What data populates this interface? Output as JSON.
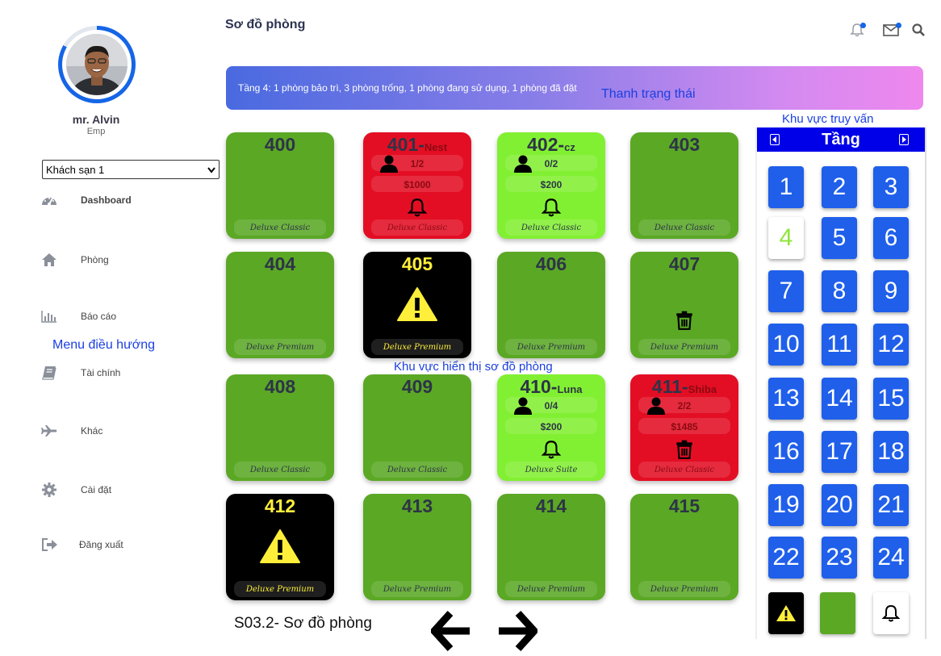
{
  "header": {
    "title": "Sơ đồ phòng"
  },
  "user": {
    "name": "mr. Alvin",
    "role": "Emp"
  },
  "hotel_select": {
    "selected": "Khách sạn 1"
  },
  "menu": [
    {
      "label": "Dashboard",
      "icon": "dashboard-icon"
    },
    {
      "label": "Phòng",
      "icon": "home-icon"
    },
    {
      "label": "Báo cáo",
      "icon": "chart-icon"
    },
    {
      "label": "Tài chính",
      "icon": "book-icon"
    },
    {
      "label": "Khác",
      "icon": "plane-icon"
    },
    {
      "label": "Cài đặt",
      "icon": "gear-icon"
    },
    {
      "label": "Đăng xuất",
      "icon": "logout-icon"
    }
  ],
  "annotations": {
    "status_bar": "Thanh trạng thái",
    "query_area": "Khu vực truy vấn",
    "menu": "Menu điều hướng",
    "room_map": "Khu vực hiển thị sơ đồ phòng"
  },
  "status_text": "Tầng 4: 1 phòng bảo trì, 3 phòng trống, 1 phòng đang sử dụng, 1 phòng đã đặt",
  "rooms": [
    {
      "number": "400",
      "type": "Deluxe Classic",
      "status": "vacant"
    },
    {
      "number": "401-",
      "guest": "Nest",
      "occupancy": "1/2",
      "price": "$1000",
      "type": "Deluxe Classic",
      "status": "occupied",
      "icon": "bell-icon"
    },
    {
      "number": "402-",
      "guest": "cz",
      "occupancy": "0/2",
      "price": "$200",
      "type": "Deluxe Classic",
      "status": "booked",
      "icon": "bell-icon"
    },
    {
      "number": "403",
      "type": "Deluxe Classic",
      "status": "vacant"
    },
    {
      "number": "404",
      "type": "Deluxe Premium",
      "status": "vacant"
    },
    {
      "number": "405",
      "type": "Deluxe Premium",
      "status": "maintenance",
      "icon": "warning-icon"
    },
    {
      "number": "406",
      "type": "Deluxe Premium",
      "status": "vacant"
    },
    {
      "number": "407",
      "type": "Deluxe Premium",
      "status": "vacant",
      "icon": "trash-icon"
    },
    {
      "number": "408",
      "type": "Deluxe Classic",
      "status": "vacant"
    },
    {
      "number": "409",
      "type": "Deluxe Classic",
      "status": "vacant"
    },
    {
      "number": "410-",
      "guest": "Luna",
      "occupancy": "0/4",
      "price": "$200",
      "type": "Deluxe Suite",
      "status": "booked",
      "icon": "bell-icon"
    },
    {
      "number": "411-",
      "guest": "Shiba",
      "occupancy": "2/2",
      "price": "$1485",
      "type": "Deluxe Classic",
      "status": "occupied",
      "icon": "trash-icon"
    },
    {
      "number": "412",
      "type": "Deluxe Premium",
      "status": "maintenance",
      "icon": "warning-icon"
    },
    {
      "number": "413",
      "type": "Deluxe Premium",
      "status": "vacant"
    },
    {
      "number": "414",
      "type": "Deluxe Premium",
      "status": "vacant"
    },
    {
      "number": "415",
      "type": "Deluxe Premium",
      "status": "vacant"
    }
  ],
  "floor_panel": {
    "title": "Tầng",
    "floors": [
      "1",
      "2",
      "3",
      "4",
      "5",
      "6",
      "7",
      "8",
      "9",
      "10",
      "11",
      "12",
      "13",
      "14",
      "15",
      "16",
      "17",
      "18",
      "19",
      "20",
      "21",
      "22",
      "23",
      "24"
    ],
    "active_floor": "4",
    "legend": [
      "warning-icon",
      "vacant-swatch",
      "bell-icon"
    ]
  },
  "caption": "S03.2- Sơ đồ phòng",
  "colors": {
    "vacant": "#5ba825",
    "booked": "#82f032",
    "occupied": "#e30e24",
    "maintenance": "#000000",
    "accent": "#1f5fea"
  }
}
